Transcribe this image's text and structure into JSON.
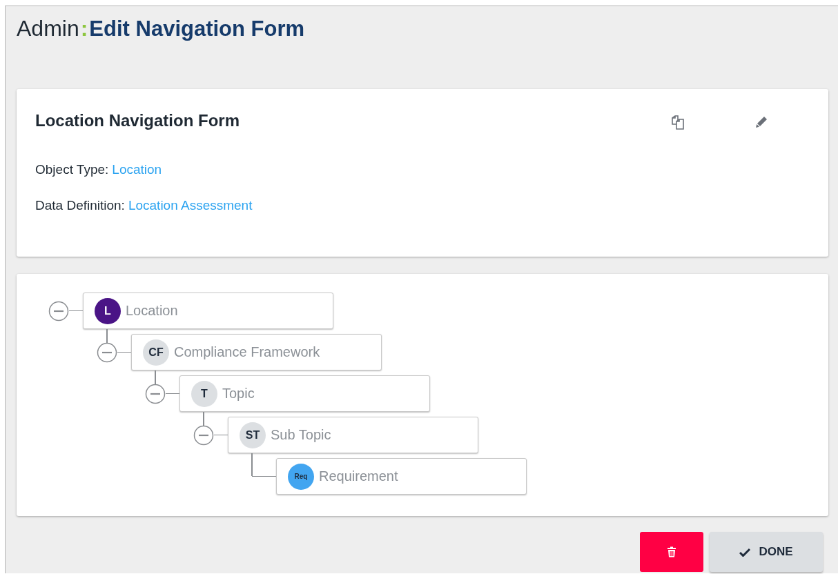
{
  "header": {
    "section": "Admin",
    "separator": ":",
    "title": "Edit Navigation Form"
  },
  "form_card": {
    "title": "Location Navigation Form",
    "fields": [
      {
        "label": "Object Type:",
        "value": "Location"
      },
      {
        "label": "Data Definition:",
        "value": "Location Assessment"
      }
    ]
  },
  "tree": [
    {
      "initials": "L",
      "label": "Location",
      "color": "#4a1486",
      "expanded": true,
      "children": [
        {
          "initials": "CF",
          "label": "Compliance Framework",
          "color": "#dcdfe2",
          "expanded": true,
          "children": [
            {
              "initials": "T",
              "label": "Topic",
              "color": "#dcdfe2",
              "expanded": true,
              "children": [
                {
                  "initials": "ST",
                  "label": "Sub Topic",
                  "color": "#dcdfe2",
                  "expanded": true,
                  "children": [
                    {
                      "initials": "Req",
                      "label": "Requirement",
                      "color": "#42a5f0"
                    }
                  ]
                }
              ]
            }
          ]
        }
      ]
    }
  ],
  "buttons": {
    "done": "DONE"
  }
}
